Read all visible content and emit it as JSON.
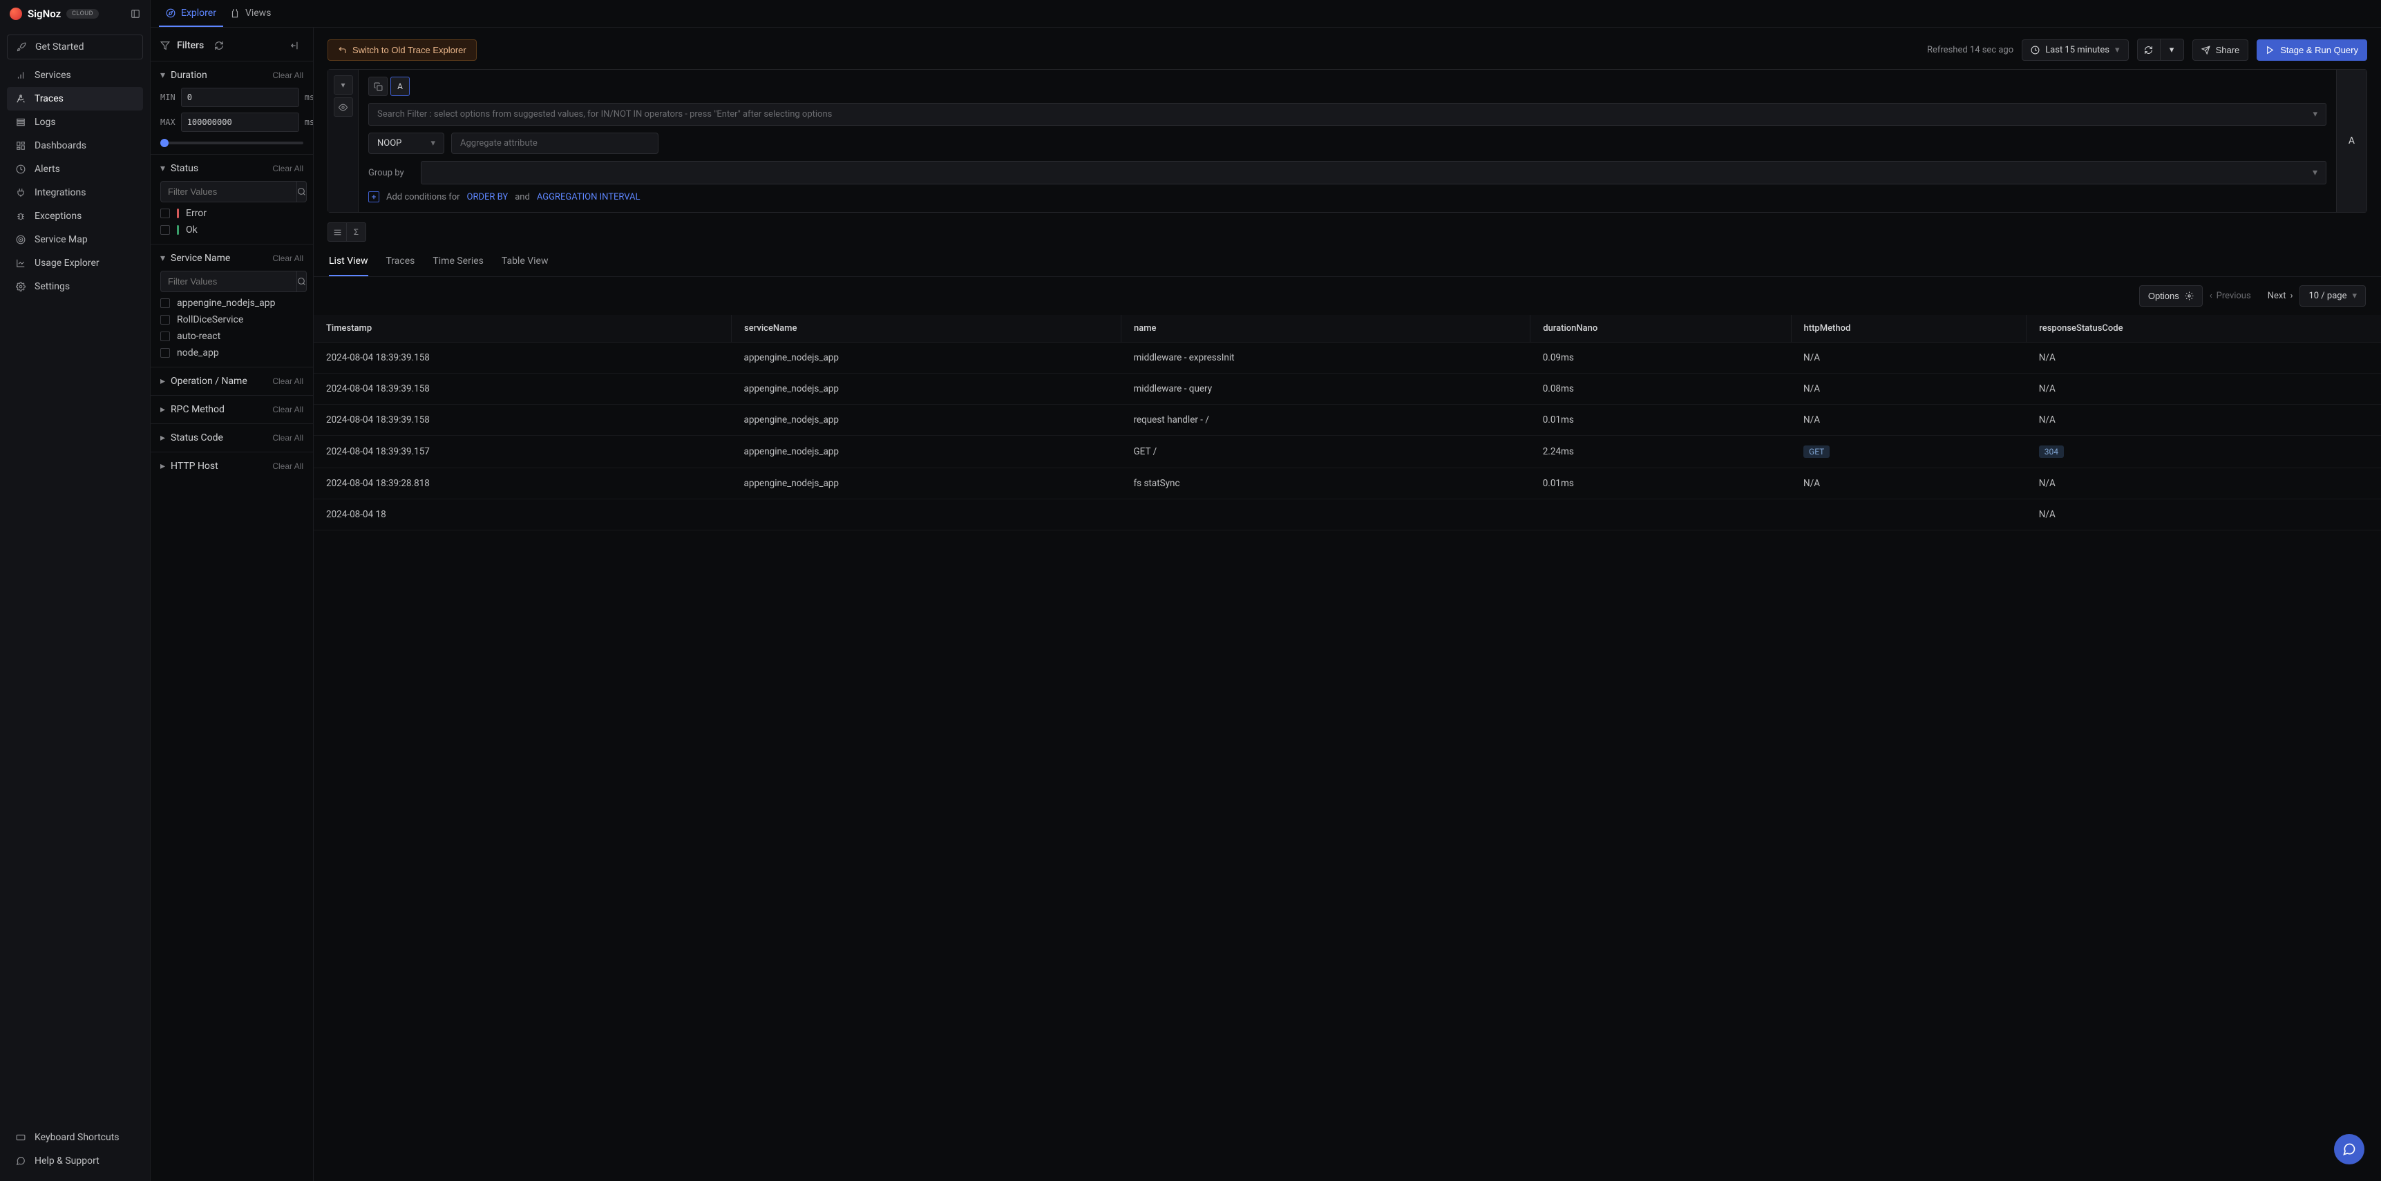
{
  "brand": {
    "name": "SigNoz",
    "badge": "CLOUD"
  },
  "sidebar": {
    "get_started": "Get Started",
    "items": [
      {
        "label": "Services"
      },
      {
        "label": "Traces"
      },
      {
        "label": "Logs"
      },
      {
        "label": "Dashboards"
      },
      {
        "label": "Alerts"
      },
      {
        "label": "Integrations"
      },
      {
        "label": "Exceptions"
      },
      {
        "label": "Service Map"
      },
      {
        "label": "Usage Explorer"
      },
      {
        "label": "Settings"
      }
    ],
    "bottom": [
      {
        "label": "Keyboard Shortcuts"
      },
      {
        "label": "Help & Support"
      }
    ]
  },
  "topnav": {
    "explorer": "Explorer",
    "views": "Views"
  },
  "filters": {
    "title": "Filters",
    "duration": {
      "title": "Duration",
      "clear": "Clear All",
      "min_label": "MIN",
      "min_value": "0",
      "max_label": "MAX",
      "max_value": "100000000",
      "unit": "ms"
    },
    "status": {
      "title": "Status",
      "clear": "Clear All",
      "search_placeholder": "Filter Values",
      "error": "Error",
      "ok": "Ok"
    },
    "service_name": {
      "title": "Service Name",
      "clear": "Clear All",
      "search_placeholder": "Filter Values",
      "items": [
        "appengine_nodejs_app",
        "RollDiceService",
        "auto-react",
        "node_app"
      ]
    },
    "operation_name": {
      "title": "Operation / Name",
      "clear": "Clear All"
    },
    "rpc_method": {
      "title": "RPC Method",
      "clear": "Clear All"
    },
    "status_code": {
      "title": "Status Code",
      "clear": "Clear All"
    },
    "http_host": {
      "title": "HTTP Host",
      "clear": "Clear All"
    }
  },
  "toolbar": {
    "switch_old": "Switch to Old Trace Explorer",
    "refreshed": "Refreshed 14 sec ago",
    "time_range": "Last 15 minutes",
    "share": "Share",
    "stage_run": "Stage & Run Query"
  },
  "builder": {
    "letter": "A",
    "search_placeholder": "Search Filter : select options from suggested values, for IN/NOT IN operators - press \"Enter\" after selecting options",
    "noop": "NOOP",
    "agg_placeholder": "Aggregate attribute",
    "group_by_label": "Group by",
    "add_cond_prefix": "Add conditions for",
    "order_by": "ORDER BY",
    "and": "and",
    "agg_interval": "AGGREGATION INTERVAL"
  },
  "result_tabs": {
    "list": "List View",
    "traces": "Traces",
    "time": "Time Series",
    "table": "Table View"
  },
  "result_bar": {
    "options": "Options",
    "previous": "Previous",
    "next": "Next",
    "per_page": "10 / page"
  },
  "table": {
    "headers": [
      "Timestamp",
      "serviceName",
      "name",
      "durationNano",
      "httpMethod",
      "responseStatusCode"
    ],
    "rows": [
      {
        "ts": "2024-08-04 18:39:39.158",
        "svc": "appengine_nodejs_app",
        "name": "middleware - expressInit",
        "dur": "0.09ms",
        "method": "N/A",
        "code": "N/A"
      },
      {
        "ts": "2024-08-04 18:39:39.158",
        "svc": "appengine_nodejs_app",
        "name": "middleware - query",
        "dur": "0.08ms",
        "method": "N/A",
        "code": "N/A"
      },
      {
        "ts": "2024-08-04 18:39:39.158",
        "svc": "appengine_nodejs_app",
        "name": "request handler - /",
        "dur": "0.01ms",
        "method": "N/A",
        "code": "N/A"
      },
      {
        "ts": "2024-08-04 18:39:39.157",
        "svc": "appengine_nodejs_app",
        "name": "GET /",
        "dur": "2.24ms",
        "method": "GET",
        "method_badge": true,
        "code": "304",
        "code_badge": true
      },
      {
        "ts": "2024-08-04 18:39:28.818",
        "svc": "appengine_nodejs_app",
        "name": "fs statSync",
        "dur": "0.01ms",
        "method": "N/A",
        "code": "N/A"
      },
      {
        "ts": "2024-08-04 18",
        "svc": "",
        "name": "",
        "dur": "",
        "method": "",
        "code": "N/A"
      }
    ]
  }
}
